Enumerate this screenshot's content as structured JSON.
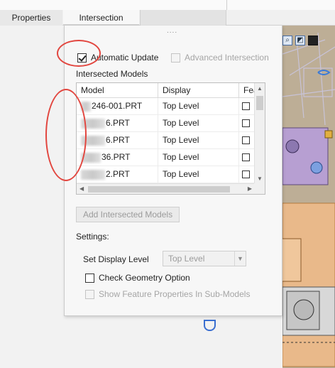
{
  "tabs": {
    "properties": "Properties",
    "intersection": "Intersection"
  },
  "panel": {
    "grip": "....",
    "automatic_update": {
      "label": "Automatic Update",
      "checked": true
    },
    "advanced_intersection": {
      "label": "Advanced Intersection",
      "checked": false,
      "enabled": false
    },
    "intersected_models_label": "Intersected Models",
    "table": {
      "columns": [
        "Model",
        "Display",
        "Feat P"
      ],
      "rows": [
        {
          "model": "246-001.PRT",
          "display": "Top Level",
          "feat": false
        },
        {
          "model": "6.PRT",
          "display": "Top Level",
          "feat": false
        },
        {
          "model": "6.PRT",
          "display": "Top Level",
          "feat": false
        },
        {
          "model": "36.PRT",
          "display": "Top Level",
          "feat": false
        },
        {
          "model": "2.PRT",
          "display": "Top Level",
          "feat": false
        }
      ]
    },
    "add_button": "Add Intersected Models",
    "settings_label": "Settings:",
    "set_display_level_label": "Set Display Level",
    "display_level_value": "Top Level",
    "check_geometry": {
      "label": "Check Geometry Option",
      "checked": false
    },
    "show_feature_properties": {
      "label": "Show Feature Properties In Sub-Models",
      "checked": false,
      "enabled": false
    }
  },
  "colors": {
    "annotation": "#e2463f",
    "viewport_bg": "#b9aa92",
    "disabled_text": "#a5a5a5"
  }
}
